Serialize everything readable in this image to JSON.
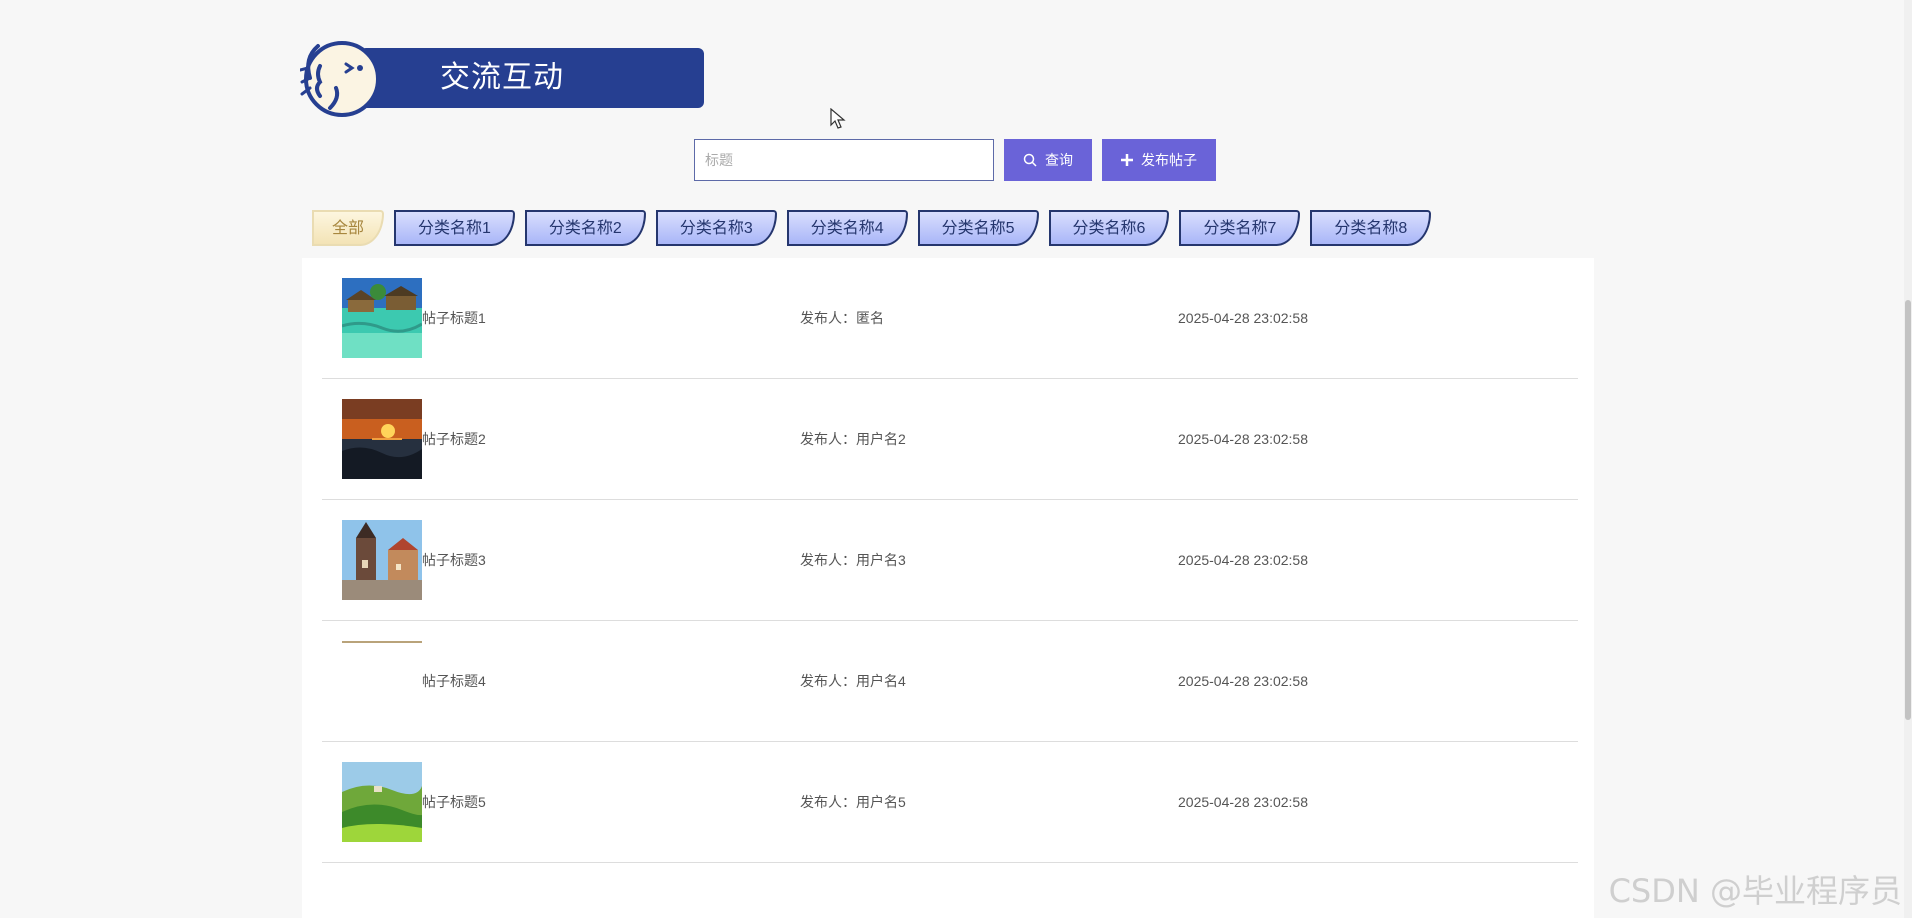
{
  "banner": {
    "title": "交流互动"
  },
  "search": {
    "placeholder": "标题",
    "value": "",
    "search_label": "查询",
    "publish_label": "发布帖子"
  },
  "categories": [
    {
      "label": "全部",
      "active": true
    },
    {
      "label": "分类名称1"
    },
    {
      "label": "分类名称2"
    },
    {
      "label": "分类名称3"
    },
    {
      "label": "分类名称4"
    },
    {
      "label": "分类名称5"
    },
    {
      "label": "分类名称6"
    },
    {
      "label": "分类名称7"
    },
    {
      "label": "分类名称8"
    }
  ],
  "posts": [
    {
      "title": "帖子标题1",
      "author": "发布人：匿名",
      "time": "2025-04-28 23:02:58",
      "image": "tropical-villa"
    },
    {
      "title": "帖子标题2",
      "author": "发布人：用户名2",
      "time": "2025-04-28 23:02:58",
      "image": "sunset-sea"
    },
    {
      "title": "帖子标题3",
      "author": "发布人：用户名3",
      "time": "2025-04-28 23:02:58",
      "image": "old-city-towers"
    },
    {
      "title": "帖子标题4",
      "author": "发布人：用户名4",
      "time": "2025-04-28 23:02:58",
      "image": "loading"
    },
    {
      "title": "帖子标题5",
      "author": "发布人：用户名5",
      "time": "2025-04-28 23:02:58",
      "image": "green-hills"
    }
  ],
  "watermark": "CSDN @毕业程序员",
  "colors": {
    "accent": "#6a63d8",
    "banner": "#263f91",
    "tab_border": "#25366e"
  }
}
